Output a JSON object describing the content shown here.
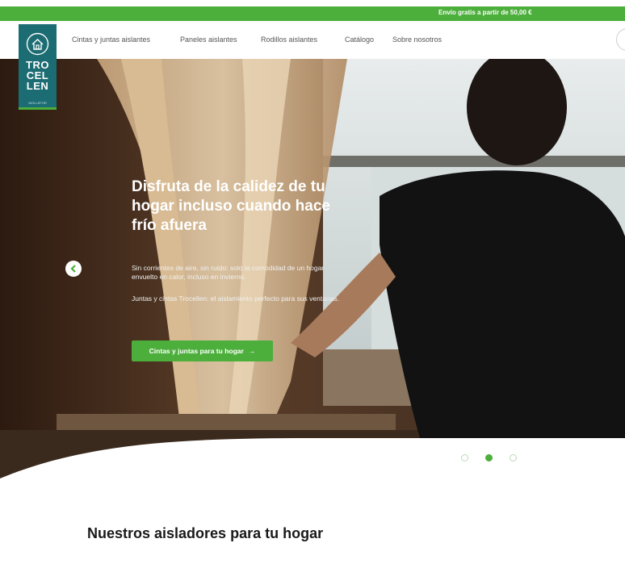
{
  "promo_bar": {
    "text": "Envío gratis a partir de 50,00 €"
  },
  "brand": {
    "name_line1": "TRO",
    "name_line2": "CEL",
    "name_line3": "LEN",
    "sub": "WOLLEFOR"
  },
  "nav": {
    "items": [
      {
        "label": "Cintas y juntas aislantes"
      },
      {
        "label": "Paneles aislantes"
      },
      {
        "label": "Rodillos aislantes"
      },
      {
        "label": "Catálogo"
      },
      {
        "label": "Sobre nosotros"
      }
    ]
  },
  "hero": {
    "title": "Disfruta de la calidez de tu hogar incluso cuando hace frío afuera",
    "paragraph1": "Sin corrientes de aire, sin ruido: solo la comodidad de un hogar envuelto en calor, incluso en invierno.",
    "paragraph2": "Juntas y cintas Trocellen: el aislamiento perfecto para sus ventanas.",
    "cta_label": "Cintas y juntas para tu hogar",
    "cta_arrow": "→",
    "prev_arrow": "‹",
    "slide_count": 3,
    "active_slide": 2
  },
  "colors": {
    "brand_green": "#4caf3c",
    "brand_teal": "#1c6c73"
  },
  "section": {
    "title": "Nuestros aisladores para tu hogar"
  }
}
